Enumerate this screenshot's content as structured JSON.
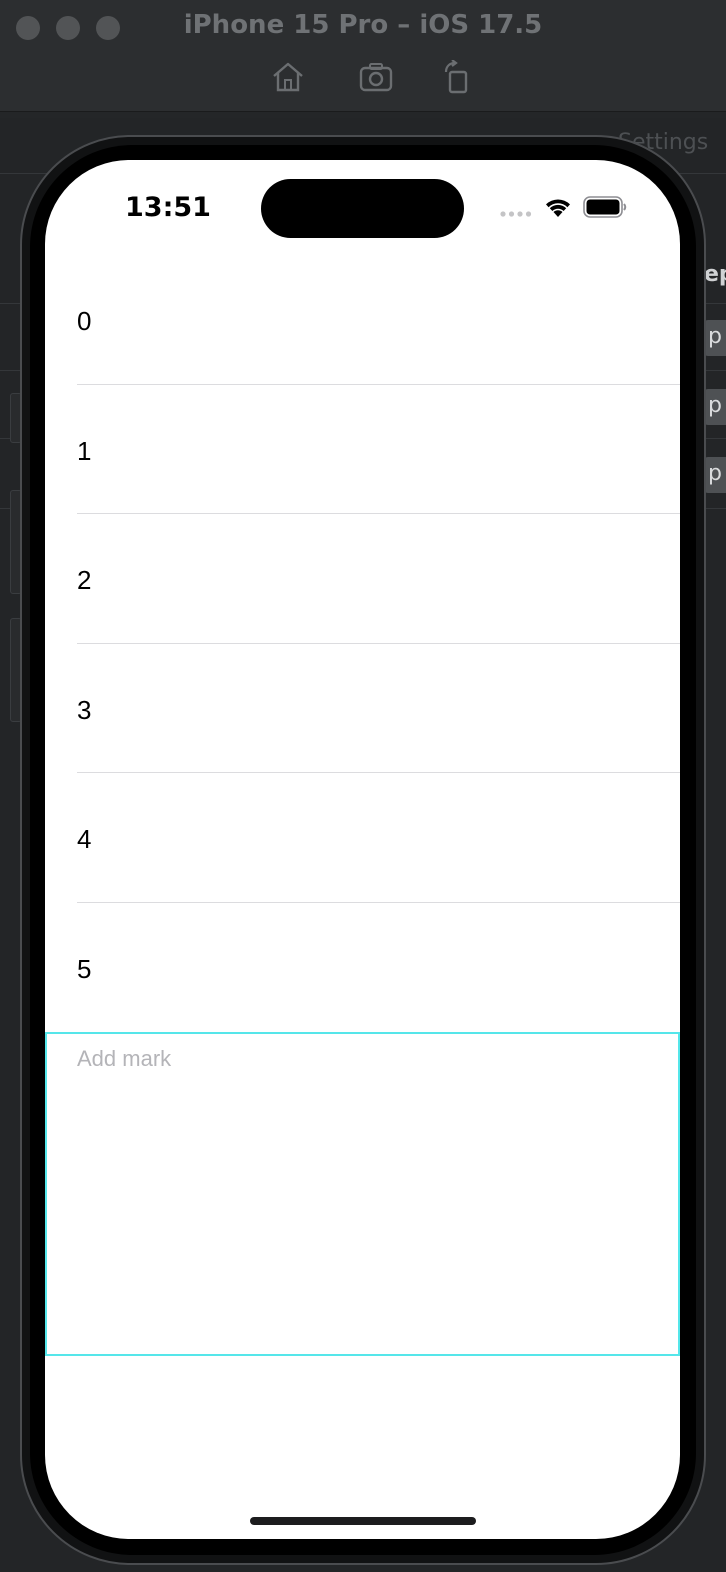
{
  "window": {
    "title": "iPhone 15 Pro – iOS 17.5",
    "toolbar": [
      "home-icon",
      "screenshot-icon",
      "rotate-icon"
    ]
  },
  "background": {
    "settings_label": "Settings",
    "ep_label": "ep",
    "chip_label": "p"
  },
  "status_bar": {
    "time": "13:51"
  },
  "list": {
    "rows": [
      {
        "label": "0"
      },
      {
        "label": "1"
      },
      {
        "label": "2"
      },
      {
        "label": "3"
      },
      {
        "label": "4"
      },
      {
        "label": "5"
      }
    ]
  },
  "mark_input": {
    "value": "",
    "placeholder": "Add mark",
    "border_color": "#55e6ea"
  }
}
